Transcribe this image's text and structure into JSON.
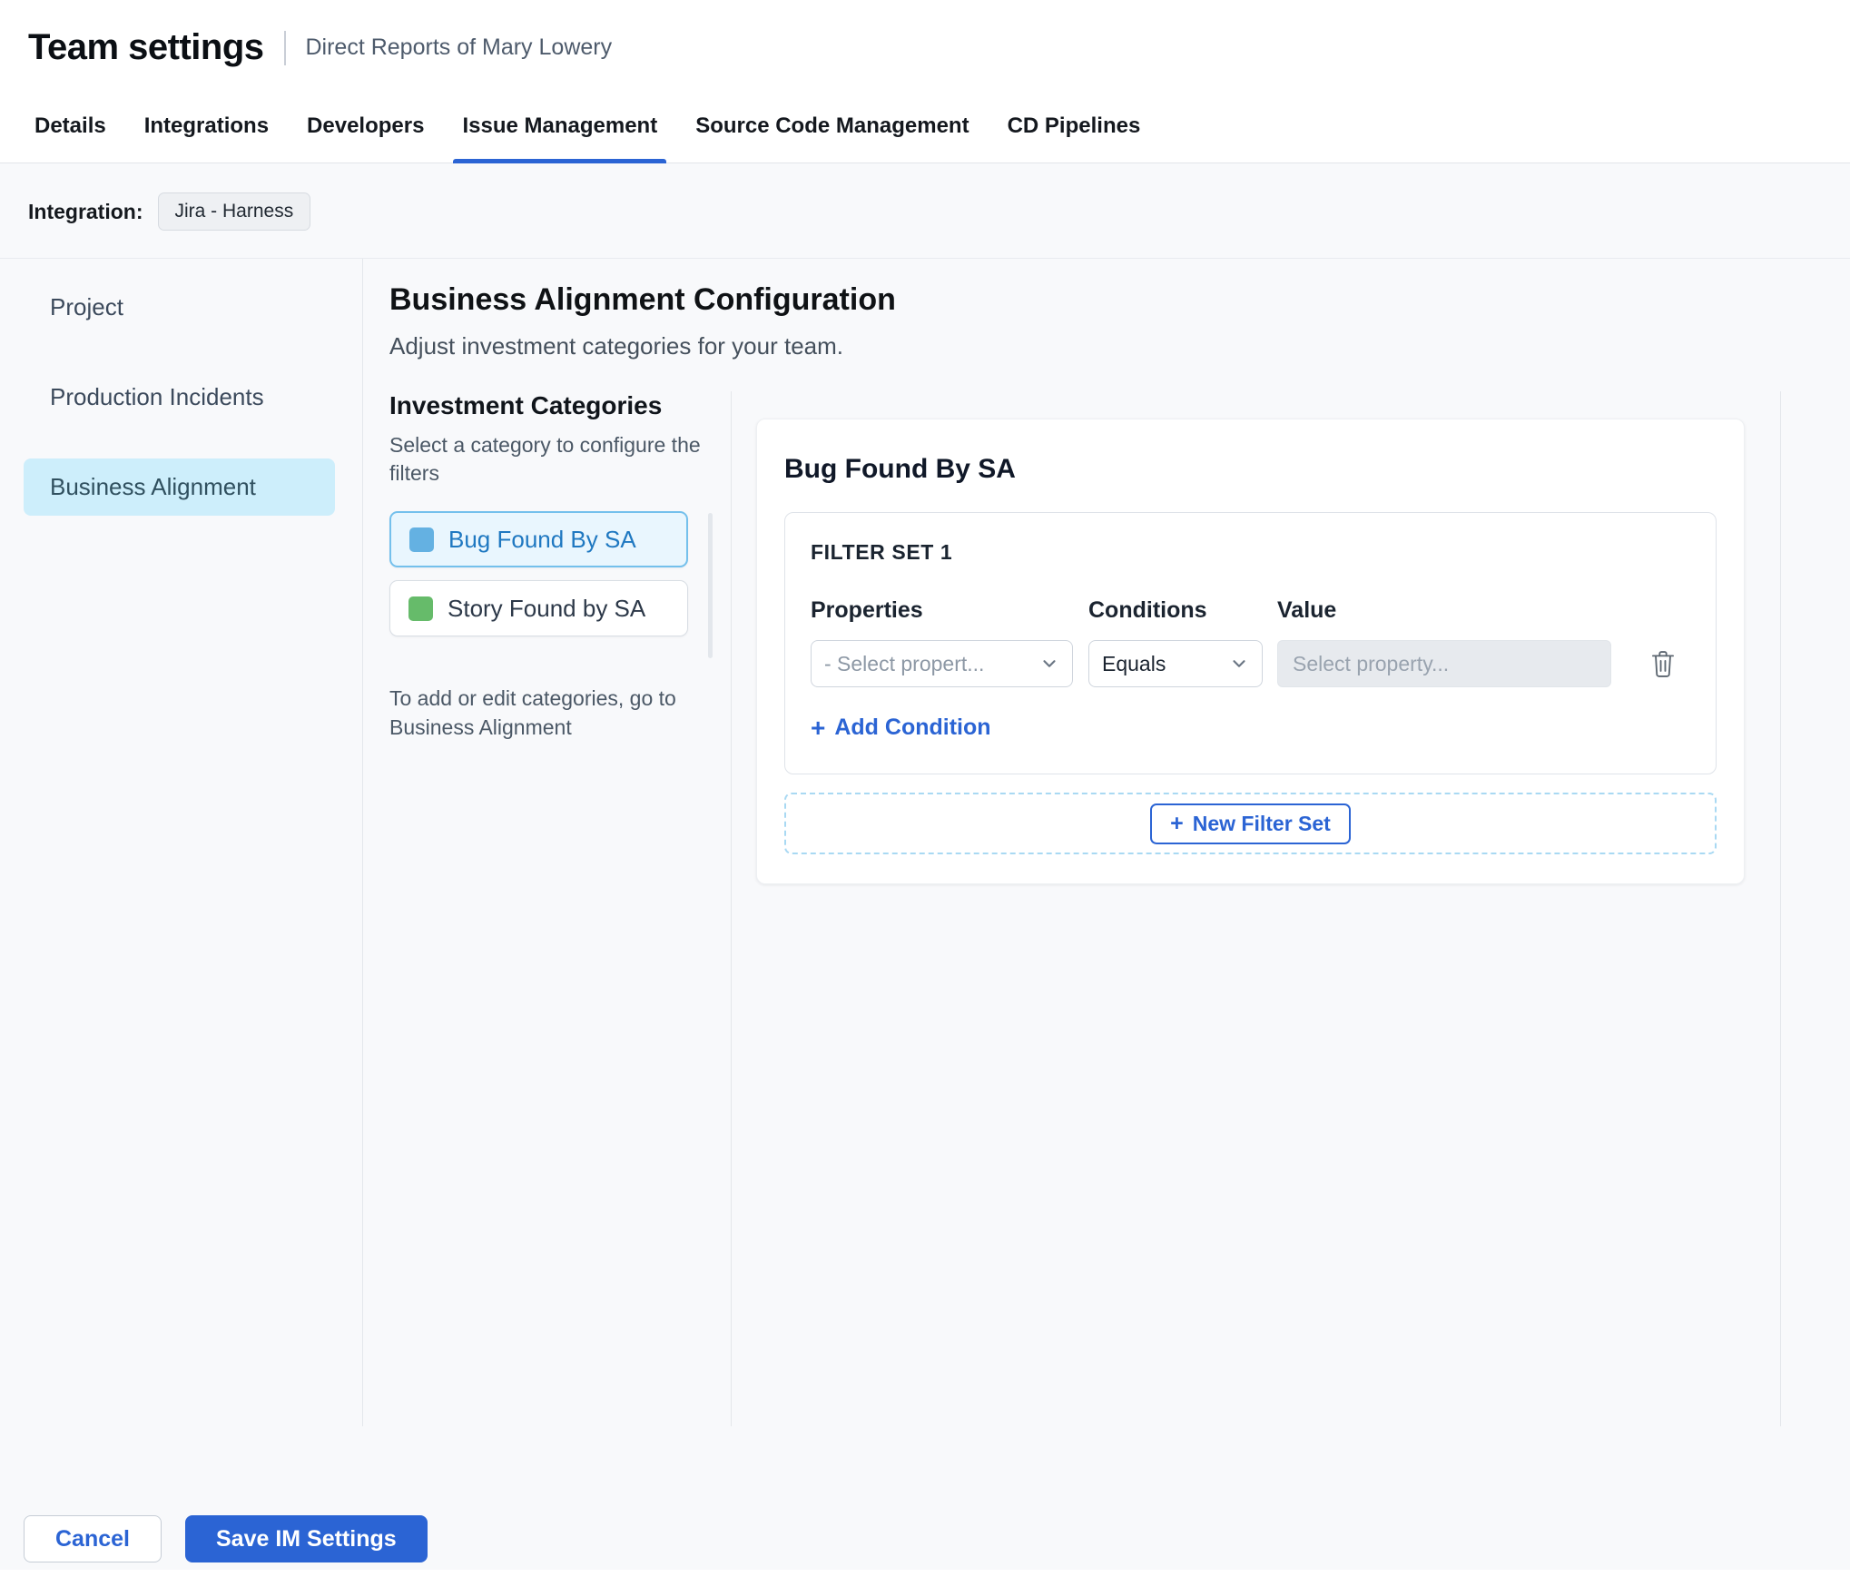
{
  "header": {
    "title": "Team settings",
    "subtitle": "Direct Reports of Mary Lowery"
  },
  "tabs": {
    "items": [
      {
        "label": "Details"
      },
      {
        "label": "Integrations"
      },
      {
        "label": "Developers"
      },
      {
        "label": "Issue Management"
      },
      {
        "label": "Source Code Management"
      },
      {
        "label": "CD Pipelines"
      }
    ],
    "active": "Issue Management"
  },
  "integration": {
    "label": "Integration:",
    "value": "Jira - Harness"
  },
  "sidebar": {
    "items": [
      {
        "label": "Project"
      },
      {
        "label": "Production Incidents"
      },
      {
        "label": "Business Alignment"
      }
    ],
    "active": "Business Alignment"
  },
  "main": {
    "title": "Business Alignment Configuration",
    "subtitle": "Adjust investment categories for your team.",
    "categories": {
      "heading": "Investment Categories",
      "helper": "Select a category to configure the filters",
      "items": [
        {
          "label": "Bug Found By SA",
          "color": "#64b1e2",
          "selected": true
        },
        {
          "label": "Story Found by SA",
          "color": "#66bb6a",
          "selected": false
        }
      ],
      "footnote": "To add or edit categories, go to Business Alignment"
    },
    "panel": {
      "title": "Bug Found By SA",
      "filter_set": {
        "heading": "FILTER SET 1",
        "columns": [
          "Properties",
          "Conditions",
          "Value"
        ],
        "property_placeholder": "- Select propert...",
        "condition_value": "Equals",
        "value_placeholder": "Select property...",
        "add_condition_label": "Add Condition"
      },
      "new_filter_set_label": "New Filter Set"
    }
  },
  "footer": {
    "cancel_label": "Cancel",
    "save_label": "Save IM Settings"
  },
  "colors": {
    "accent": "#2b64d4",
    "tab_underline": "#2b64d4",
    "page_bg": "#f8f9fb",
    "sidebar_active_bg": "#cdeefb",
    "category_selected_bg": "#e9f6fe",
    "category_selected_border": "#74c0ec",
    "category_selected_text": "#1f78c1",
    "bug_square": "#64b1e2",
    "story_square": "#66bb6a",
    "dashed_border": "#a9d9f3",
    "disabled_input_bg": "#e7eaee"
  }
}
